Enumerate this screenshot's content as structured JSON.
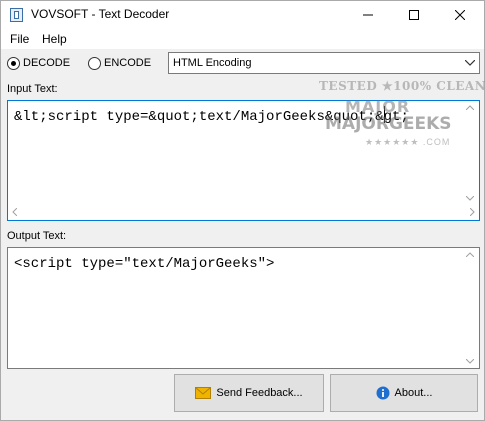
{
  "window": {
    "title": "VOVSOFT - Text Decoder"
  },
  "menu": {
    "items": [
      {
        "label": "File"
      },
      {
        "label": "Help"
      }
    ]
  },
  "mode": {
    "decode_label": "DECODE",
    "encode_label": "ENCODE",
    "selected": "DECODE"
  },
  "encoding": {
    "selected": "HTML Encoding"
  },
  "input": {
    "label": "Input Text:",
    "value": "&lt;script type=&quot;text/MajorGeeks&quot;&gt;"
  },
  "output": {
    "label": "Output Text:",
    "value": "<script type=\"text/MajorGeeks\">"
  },
  "buttons": {
    "feedback_label": "Send Feedback...",
    "about_label": "About..."
  },
  "watermark": {
    "line1": "TESTED ★100% CLEAN",
    "line2": "MAJOR",
    "line3": "MAJORGEEKS",
    "line4": "★★★★★★ .COM"
  },
  "icons": {
    "app": "text-decoder-app-icon",
    "minimize": "minimize-icon",
    "maximize": "maximize-icon",
    "close": "close-icon",
    "dropdown": "chevron-down-icon",
    "feedback": "envelope-icon",
    "about": "info-icon"
  },
  "colors": {
    "focus_border": "#0078d7",
    "button_face": "#e1e1e1",
    "about_icon": "#1f6fd1",
    "feedback_icon": "#f0b400"
  }
}
